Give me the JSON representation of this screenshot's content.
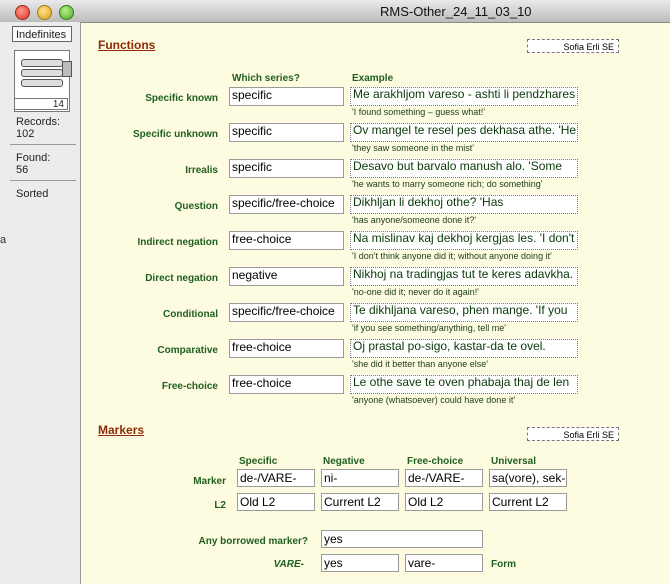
{
  "window": {
    "title": "RMS-Other_24_11_03_10"
  },
  "status": {
    "layout": "Indefinites",
    "record_number": "14",
    "records_label": "Records:",
    "records_value": "102",
    "found_label": "Found:",
    "found_value": "56",
    "sort_status": "Sorted",
    "edge_text": "a"
  },
  "functions": {
    "title": "Functions",
    "badge": "Sofia Erli SE",
    "col_series": "Which series?",
    "col_example": "Example",
    "rows": [
      {
        "label": "Specific known",
        "series": "specific",
        "example": "Me arakhljom vareso - ashti li pendzhares",
        "translation": "'I found something – guess what!'"
      },
      {
        "label": "Specific unknown",
        "series": "specific",
        "example": "Ov mangel te resel pes dekhasa athe. 'He",
        "translation": "'they saw someone in the mist'"
      },
      {
        "label": "Irrealis",
        "series": "specific",
        "example": "Desavo but barvalo manush alo. 'Some",
        "translation": "'he wants to marry someone rich; do something'"
      },
      {
        "label": "Question",
        "series": "specific/free-choice",
        "example": "Dikhljan li dekhoj othe? 'Has",
        "translation": "'has anyone/someone done it?'"
      },
      {
        "label": "Indirect negation",
        "series": "free-choice",
        "example": "Na mislinav kaj dekhoj kergjas les. 'I don't",
        "translation": "'I don't think anyone did it; without anyone doing it'"
      },
      {
        "label": "Direct negation",
        "series": "negative",
        "example": "Nikhoj na tradingjas tut te keres adavkha.",
        "translation": "'no-one did it; never do it again!'"
      },
      {
        "label": "Conditional",
        "series": "specific/free-choice",
        "example": "Te dikhljana vareso, phen mange. 'If you",
        "translation": "'if you see something/anything, tell me'"
      },
      {
        "label": "Comparative",
        "series": "free-choice",
        "example": "Oj prastal po-sigo, kastar-da te ovel.",
        "translation": "'she did it better than anyone else'"
      },
      {
        "label": "Free-choice",
        "series": "free-choice",
        "example": "Le othe save te oven phabaja thaj de len",
        "translation": "'anyone (whatsoever) could have done it'"
      }
    ]
  },
  "markers": {
    "title": "Markers",
    "badge": "Sofia Erli SE",
    "headers": [
      "Specific",
      "Negative",
      "Free-choice",
      "Universal"
    ],
    "marker_label": "Marker",
    "l2_label": "L2",
    "marker_values": [
      "de-/VARE-",
      "ni-",
      "de-/VARE-",
      "sa(vore), sek-"
    ],
    "l2_values": [
      "Old L2",
      "Current L2",
      "Old L2",
      "Current L2"
    ],
    "borrowed_label": "Any borrowed marker?",
    "borrowed_value": "yes",
    "vare_label": "VARE-",
    "vare_value": "yes",
    "vare_form": "vare-",
    "form_label": "Form"
  }
}
